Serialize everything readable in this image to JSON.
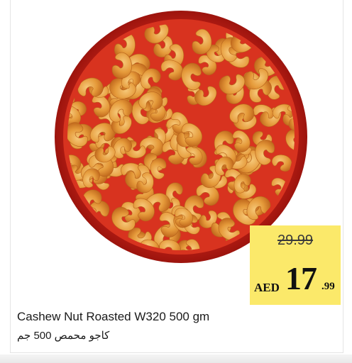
{
  "product": {
    "name_en": "Cashew Nut Roasted W320 500 gm",
    "name_ar": "كاجو محمص 500 جم",
    "image_icon": "roasted-cashews-bowl-image"
  },
  "price": {
    "old": "29.99",
    "currency": "AED",
    "integer": "17",
    "decimal": ".99"
  },
  "colors": {
    "price_badge": "#fbe96a",
    "plate": "#c8231a",
    "cashew": "#e59a3a"
  }
}
